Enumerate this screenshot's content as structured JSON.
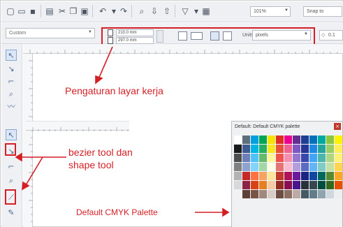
{
  "toolbar": {
    "icons": [
      "new-icon",
      "open-icon",
      "save-icon",
      "print-icon",
      "cut-icon",
      "copy-icon",
      "paste-icon",
      "undo-icon",
      "redo-icon",
      "search-icon",
      "import-icon",
      "export-icon",
      "publish-icon",
      "launcher-icon"
    ],
    "zoom_value": "101%",
    "snap_value": "Snap to"
  },
  "propbar": {
    "preset_value": "Custom",
    "width_value": "210.0 mm",
    "height_value": "297.0 mm",
    "units_label": "Units:",
    "units_value": "pixels",
    "nudge_value": "0.1"
  },
  "annotations": {
    "workspace": "Pengaturan layar kerja",
    "bezier_line1": "bezier tool dan",
    "bezier_line2": "shape tool",
    "palette": "Default CMYK Palette"
  },
  "palette": {
    "title": "Default: Default CMYK palette",
    "colors": [
      "#ffffff",
      "#5c6f7a",
      "#00a0e0",
      "#00a651",
      "#f7e200",
      "#e02d24",
      "#ec008c",
      "#662d91",
      "#1c3f94",
      "#0072bc",
      "#00a99d",
      "#8dc63f",
      "#fff200",
      "#1a1a1a",
      "#3f5b8f",
      "#00b4e4",
      "#27ae60",
      "#f8e71c",
      "#e55039",
      "#f06292",
      "#7e57c2",
      "#283593",
      "#1e88e5",
      "#26a69a",
      "#9ccc65",
      "#ffee58",
      "#4d4d4d",
      "#6b7fb8",
      "#4fc3f7",
      "#66bb6a",
      "#fff59d",
      "#ef5350",
      "#f48fb1",
      "#9575cd",
      "#3949ab",
      "#42a5f5",
      "#4db6ac",
      "#aed581",
      "#fff176",
      "#808080",
      "#8fa3cf",
      "#81d4fa",
      "#a5d6a7",
      "#fffde7",
      "#e57373",
      "#f8bbd0",
      "#b39ddb",
      "#5c6bc0",
      "#64b5f6",
      "#80cbc4",
      "#c5e1a5",
      "#ffd54f",
      "#b3b3b3",
      "#c62828",
      "#ff7043",
      "#f4a460",
      "#fde69a",
      "#c0392b",
      "#ad1457",
      "#6a1b9a",
      "#1a237e",
      "#0d47a1",
      "#00695c",
      "#558b2f",
      "#f9a825",
      "#d9d9d9",
      "#8e2443",
      "#d84315",
      "#e67e22",
      "#f5cba7",
      "#922b21",
      "#880e4f",
      "#4a148c",
      "#263238",
      "#37474f",
      "#004d40",
      "#33691e",
      "#e65100",
      "#f2f2f2",
      "#5d4037",
      "#795548",
      "#a1887f",
      "#d7ccc8",
      "#6d4c41",
      "#8d6e63",
      "#bcaaa4",
      "#455a64",
      "#607d8b",
      "#90a4ae",
      "#cfd8dc",
      "#eceff1"
    ]
  },
  "colors": {
    "annotation": "#d41f26",
    "ui_bg": "#eef0f3"
  }
}
